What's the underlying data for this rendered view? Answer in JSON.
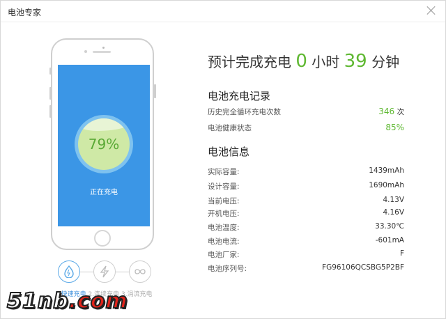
{
  "window": {
    "title": "电池专家"
  },
  "phone": {
    "percent": "79%",
    "status": "正在充电"
  },
  "steps": {
    "labels": [
      "1.快速充电",
      "2.连续充电",
      "3.涓流充电"
    ]
  },
  "headline": {
    "prefix": "预计完成充电",
    "hours": "0",
    "hours_unit": "小时",
    "minutes": "39",
    "minutes_unit": "分钟"
  },
  "charge_record": {
    "title": "电池充电记录",
    "cycles_label": "历史完全循环充电次数",
    "cycles_value": "346",
    "cycles_unit": "次",
    "health_label": "电池健康状态",
    "health_value": "85%"
  },
  "battery_info": {
    "title": "电池信息",
    "rows": [
      {
        "label": "实际容量:",
        "value": "1439mAh"
      },
      {
        "label": "设计容量:",
        "value": "1690mAh"
      },
      {
        "label": "当前电压:",
        "value": "4.13V"
      },
      {
        "label": "开机电压:",
        "value": "4.16V"
      },
      {
        "label": "电池温度:",
        "value": "33.30℃"
      },
      {
        "label": "电池电流:",
        "value": "-601mA"
      },
      {
        "label": "电池厂家:",
        "value": "F"
      },
      {
        "label": "电池序列号:",
        "value": "FG96106QCSBG5P2BF"
      }
    ]
  },
  "watermark": {
    "part1": "51nb",
    "part2": ".com"
  },
  "colors": {
    "accent_green": "#5fb832",
    "screen_blue": "#3b96e6"
  }
}
